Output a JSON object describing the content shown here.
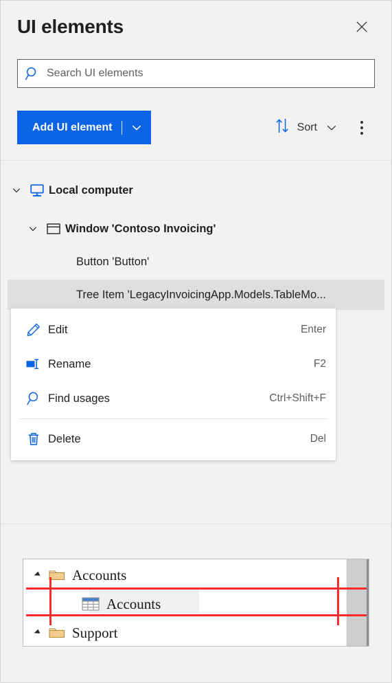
{
  "header": {
    "title": "UI elements",
    "close_icon": "close-icon"
  },
  "search": {
    "placeholder": "Search UI elements",
    "value": "",
    "icon": "search-icon"
  },
  "toolbar": {
    "add_label": "Add UI element",
    "add_dropdown_icon": "chevron-down-icon",
    "sort_label": "Sort",
    "sort_icon": "sort-arrows-icon",
    "sort_chevron_icon": "chevron-down-icon",
    "more_icon": "more-vertical-icon",
    "accent_color": "#0b63e5"
  },
  "tree": {
    "items": [
      {
        "label": "Local computer",
        "icon": "monitor-icon",
        "expanded": true,
        "depth": 0,
        "selected": false,
        "bold": true
      },
      {
        "label": "Window 'Contoso Invoicing'",
        "icon": "window-icon",
        "expanded": true,
        "depth": 1,
        "selected": false,
        "bold": true
      },
      {
        "label": "Button 'Button'",
        "icon": "none",
        "expanded": null,
        "depth": 2,
        "selected": false,
        "bold": false
      },
      {
        "label": "Tree Item 'LegacyInvoicingApp.Models.TableMo...",
        "icon": "none",
        "expanded": null,
        "depth": 2,
        "selected": true,
        "bold": false
      }
    ]
  },
  "context_menu": {
    "items": [
      {
        "label": "Edit",
        "shortcut": "Enter",
        "icon": "pencil-icon",
        "separator_after": false
      },
      {
        "label": "Rename",
        "shortcut": "F2",
        "icon": "rename-icon",
        "separator_after": false
      },
      {
        "label": "Find usages",
        "shortcut": "Ctrl+Shift+F",
        "icon": "magnifier-icon",
        "separator_after": true
      },
      {
        "label": "Delete",
        "shortcut": "Del",
        "icon": "trash-icon",
        "separator_after": false
      }
    ]
  },
  "preview": {
    "rows": [
      {
        "label": "Accounts",
        "icon": "folder-icon",
        "expander": "triangle-collapsed",
        "indent": 0,
        "highlighted": false
      },
      {
        "label": "Accounts",
        "icon": "table-icon",
        "expander": "none",
        "indent": 1,
        "highlighted": true
      },
      {
        "label": "Support",
        "icon": "folder-icon",
        "expander": "triangle-collapsed",
        "indent": 0,
        "highlighted": false
      }
    ],
    "marker_color": "#fb2b2b",
    "scrollbar": "vertical-scrollbar"
  }
}
